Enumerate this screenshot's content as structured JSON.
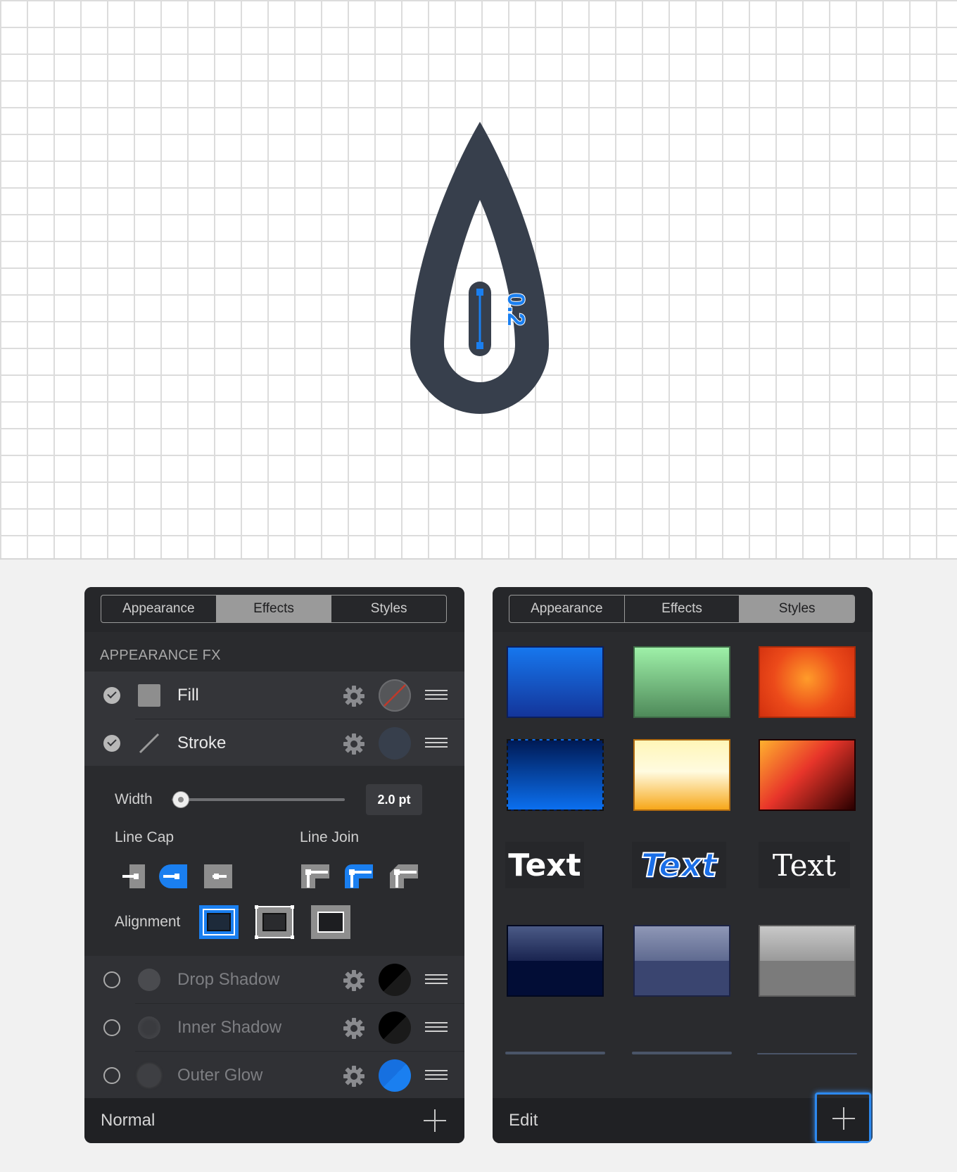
{
  "canvas": {
    "dimension_label": "0.2",
    "shape_color": "#373f4c",
    "accent": "#1a7ff0"
  },
  "left_panel": {
    "tabs": [
      {
        "label": "Appearance",
        "active": false
      },
      {
        "label": "Effects",
        "active": true
      },
      {
        "label": "Styles",
        "active": false
      }
    ],
    "section_title": "APPEARANCE FX",
    "fx_items": [
      {
        "label": "Fill",
        "enabled": true,
        "icon": "square-fill-icon",
        "swatch": "none"
      },
      {
        "label": "Stroke",
        "enabled": true,
        "icon": "line-stroke-icon",
        "swatch": "#373f4c"
      },
      {
        "label": "Drop Shadow",
        "enabled": false,
        "icon": "circle-icon",
        "swatch": "#000000"
      },
      {
        "label": "Inner Shadow",
        "enabled": false,
        "icon": "circle-icon",
        "swatch": "#000000"
      },
      {
        "label": "Outer Glow",
        "enabled": false,
        "icon": "circle-icon",
        "swatch": "#1a7ff0"
      }
    ],
    "stroke_options": {
      "width_label": "Width",
      "width_value": "2.0 pt",
      "line_cap_label": "Line Cap",
      "line_join_label": "Line Join",
      "alignment_label": "Alignment",
      "selected_cap": 1,
      "selected_join": 1,
      "selected_alignment": 0
    },
    "footer": {
      "blend_mode": "Normal"
    }
  },
  "right_panel": {
    "tabs": [
      {
        "label": "Appearance",
        "active": false
      },
      {
        "label": "Effects",
        "active": false
      },
      {
        "label": "Styles",
        "active": true
      }
    ],
    "text_styles": [
      "Text",
      "Text",
      "Text"
    ],
    "footer": {
      "edit_label": "Edit"
    }
  }
}
